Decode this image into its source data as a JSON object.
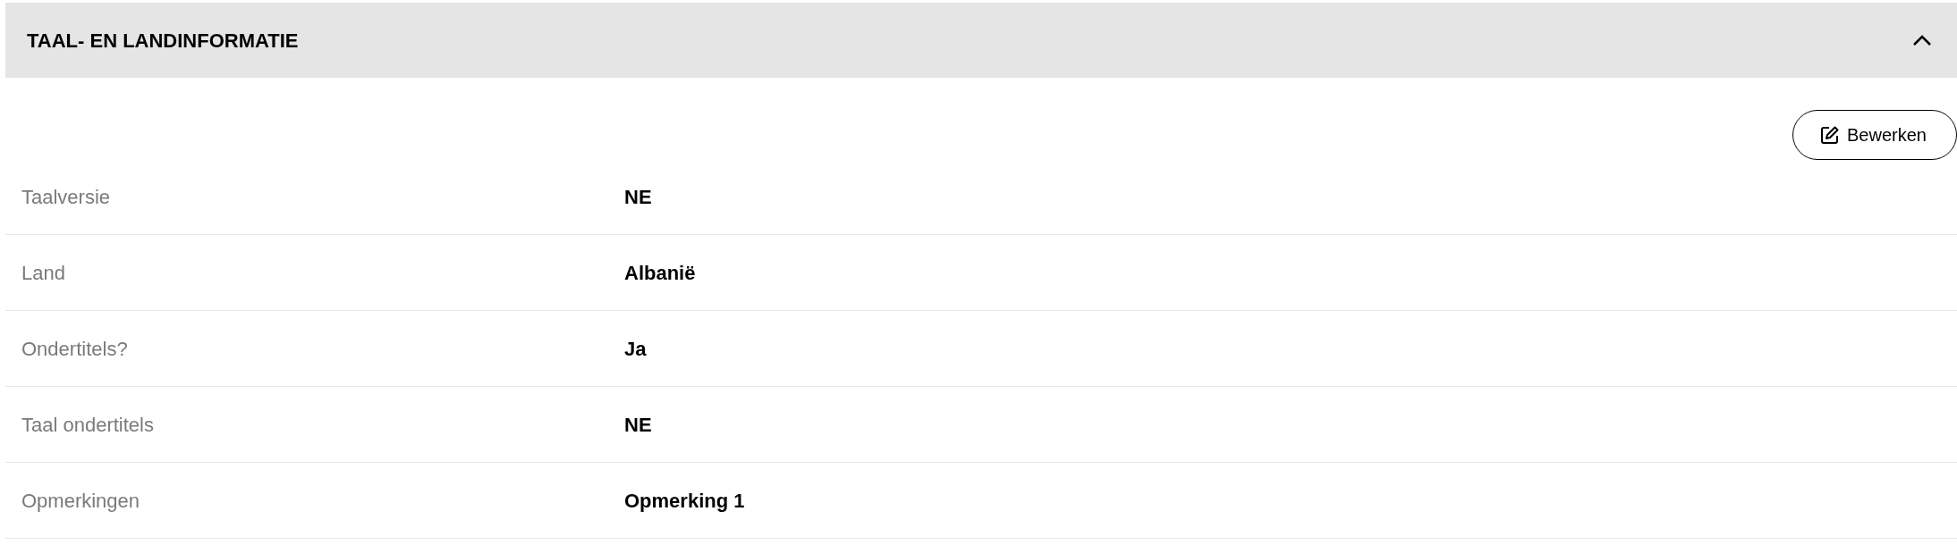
{
  "section": {
    "title": "TAAL- EN LANDINFORMATIE",
    "expanded": true
  },
  "edit_button": {
    "label": "Bewerken"
  },
  "rows": [
    {
      "label": "Taalversie",
      "value": "NE"
    },
    {
      "label": "Land",
      "value": "Albanië"
    },
    {
      "label": "Ondertitels?",
      "value": "Ja"
    },
    {
      "label": "Taal ondertitels",
      "value": "NE"
    },
    {
      "label": "Opmerkingen",
      "value": "Opmerking 1"
    }
  ]
}
